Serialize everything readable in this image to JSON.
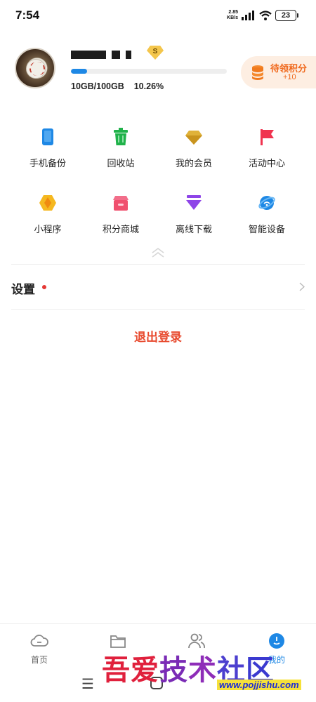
{
  "status_bar": {
    "time": "7:54",
    "net_speed_value": "2.85",
    "net_speed_unit": "KB/s",
    "battery": "23"
  },
  "profile": {
    "storage_used_text": "10GB/100GB",
    "storage_percent_text": "10.26%",
    "storage_fraction": 0.1026,
    "vip_badge_letter": "S",
    "points_title": "待领积分",
    "points_value": "+10"
  },
  "features": [
    {
      "label": "手机备份",
      "icon": "phone-backup-icon",
      "color": "#1e88e5"
    },
    {
      "label": "回收站",
      "icon": "trash-icon",
      "color": "#20b24a"
    },
    {
      "label": "我的会员",
      "icon": "diamond-icon",
      "color": "#d9a521"
    },
    {
      "label": "活动中心",
      "icon": "flag-icon",
      "color": "#f0334f"
    },
    {
      "label": "小程序",
      "icon": "mini-program-icon",
      "color": "#f5a623"
    },
    {
      "label": "积分商城",
      "icon": "shop-icon",
      "color": "#f0506e"
    },
    {
      "label": "离线下载",
      "icon": "download-icon",
      "color": "#8e44e8"
    },
    {
      "label": "智能设备",
      "icon": "smart-device-icon",
      "color": "#1e88e5"
    }
  ],
  "settings": {
    "label": "设置",
    "has_red_dot": true
  },
  "logout_label": "退出登录",
  "bottom_nav": {
    "items": [
      {
        "label": "首页",
        "icon": "cloud-home-icon",
        "active": false
      },
      {
        "label": "",
        "icon": "folder-icon",
        "active": false
      },
      {
        "label": "",
        "icon": "people-icon",
        "active": false
      },
      {
        "label": "我的",
        "icon": "profile-icon",
        "active": true
      }
    ],
    "active_color": "#1e88e5"
  },
  "watermark": {
    "text": "吾爱技术社区",
    "url": "www.pojjishu.com"
  }
}
